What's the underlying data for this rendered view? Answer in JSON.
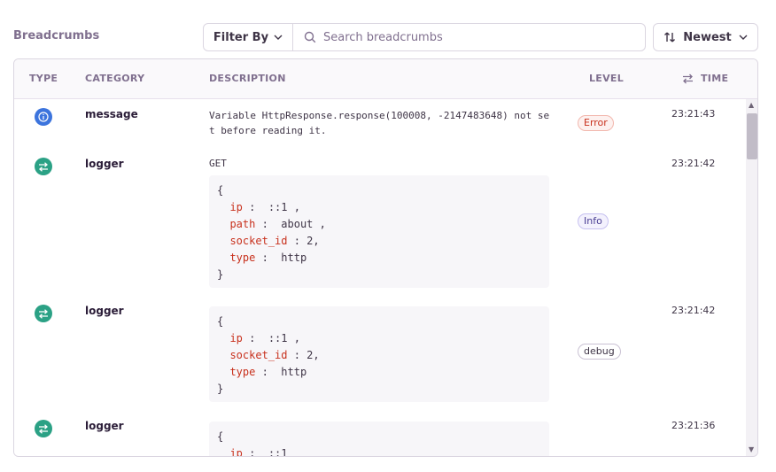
{
  "header": {
    "title": "Breadcrumbs",
    "filter_label": "Filter By",
    "search_placeholder": "Search breadcrumbs",
    "sort_label": "Newest"
  },
  "table": {
    "columns": {
      "type": "TYPE",
      "category": "CATEGORY",
      "description": "DESCRIPTION",
      "level": "LEVEL",
      "time": "TIME"
    },
    "rows": [
      {
        "icon": "info-icon",
        "category": "message",
        "description": "Variable HttpResponse.response(100008, -2147483648) not set before reading it.",
        "level": "Error",
        "time": "23:21:43"
      },
      {
        "icon": "exchange-icon",
        "category": "logger",
        "title": "GET",
        "code": {
          "open": "{",
          "close": "}",
          "lines": [
            {
              "key": "ip",
              "sep": " :  ",
              "val": "::1",
              "end": " ,"
            },
            {
              "key": "path",
              "sep": " :  ",
              "val": "about",
              "end": " ,"
            },
            {
              "key": "socket_id",
              "sep": " : ",
              "val": "2",
              "end": ","
            },
            {
              "key": "type",
              "sep": " :  ",
              "val": "http",
              "end": ""
            }
          ]
        },
        "level": "Info",
        "time": "23:21:42"
      },
      {
        "icon": "exchange-icon",
        "category": "logger",
        "code": {
          "open": "{",
          "close": "}",
          "lines": [
            {
              "key": "ip",
              "sep": " :  ",
              "val": "::1",
              "end": " ,"
            },
            {
              "key": "socket_id",
              "sep": " : ",
              "val": "2",
              "end": ","
            },
            {
              "key": "type",
              "sep": " :  ",
              "val": "http",
              "end": ""
            }
          ]
        },
        "level": "debug",
        "time": "23:21:42"
      },
      {
        "icon": "exchange-icon",
        "category": "logger",
        "code": {
          "open": "{",
          "lines": [
            {
              "key": "ip",
              "sep": " :  ",
              "val": "::1",
              "end": ""
            }
          ]
        },
        "time": "23:21:36"
      }
    ]
  },
  "colors": {
    "info_icon": "#3c74dd",
    "logger_icon": "#2ba185",
    "code_key": "#c8311d"
  }
}
